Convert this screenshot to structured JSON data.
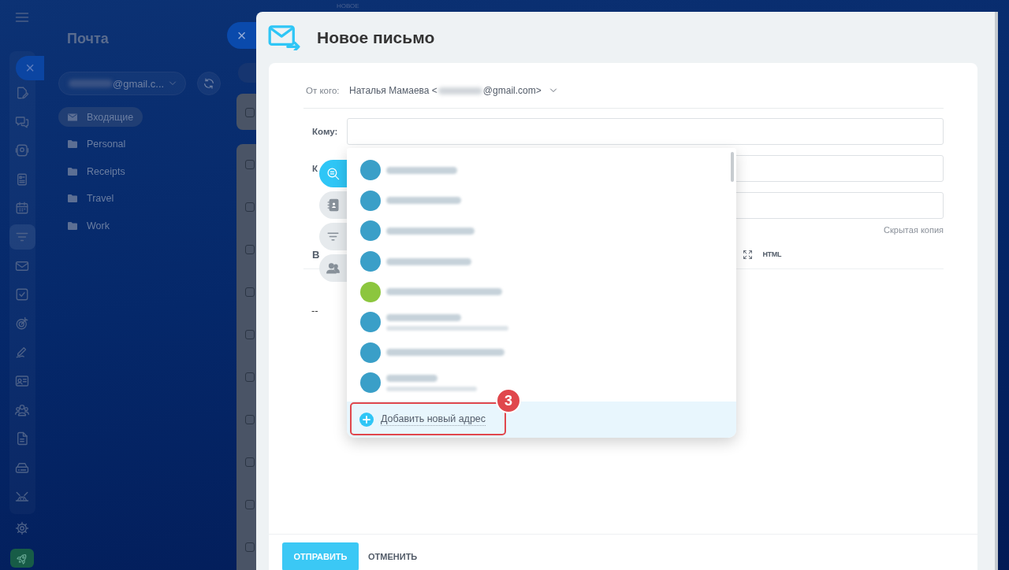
{
  "top_tab": {
    "label": "НОВОЕ"
  },
  "rail": {
    "close_button": {
      "label": "×"
    },
    "items": [
      {
        "kind": "edit",
        "selected": false
      },
      {
        "kind": "chat",
        "selected": false
      },
      {
        "kind": "contact",
        "selected": false
      },
      {
        "kind": "news",
        "selected": false
      },
      {
        "kind": "calendar",
        "selected": false
      },
      {
        "kind": "filter",
        "selected": true
      },
      {
        "kind": "mail",
        "selected": false
      },
      {
        "kind": "task",
        "selected": false
      },
      {
        "kind": "target",
        "selected": false
      },
      {
        "kind": "signature",
        "selected": false
      },
      {
        "kind": "id-card",
        "selected": false
      },
      {
        "kind": "people",
        "selected": false
      },
      {
        "kind": "document",
        "selected": false
      },
      {
        "kind": "drive",
        "selected": false
      },
      {
        "kind": "robot",
        "selected": false
      }
    ],
    "bottom_items": [
      {
        "kind": "settings"
      },
      {
        "kind": "rocket"
      }
    ]
  },
  "mail_panel": {
    "title": "Почта",
    "close_button": {
      "label": "×"
    },
    "account": {
      "visible_text": "@gmail.c..."
    },
    "folders": [
      {
        "kind": "inbox",
        "label": "Входящие",
        "selected": true
      },
      {
        "kind": "folder",
        "label": "Personal",
        "selected": false
      },
      {
        "kind": "folder",
        "label": "Receipts",
        "selected": false
      },
      {
        "kind": "folder",
        "label": "Travel",
        "selected": false
      },
      {
        "kind": "folder",
        "label": "Work",
        "selected": false
      }
    ]
  },
  "message_list": {
    "groups": [
      {
        "rows": [
          {
            "checked": false
          }
        ]
      },
      {
        "rows": [
          {
            "checked": false
          },
          {
            "checked": false
          },
          {
            "checked": false
          },
          {
            "checked": false
          },
          {
            "checked": false
          },
          {
            "checked": false
          },
          {
            "checked": false
          },
          {
            "checked": false
          },
          {
            "checked": false
          },
          {
            "checked": false
          }
        ]
      }
    ]
  },
  "compose": {
    "title": "Новое письмо",
    "from": {
      "label": "От кого:",
      "name": "Наталья Мамаева <",
      "domain": "@gmail.com>"
    },
    "fields": [
      {
        "kind": "labeled",
        "label": "Кому:"
      },
      {
        "kind": "labeled",
        "label": "К"
      },
      {
        "kind": "unlabeled"
      }
    ],
    "bcc_link": "Скрытая копия",
    "toolbar": {
      "bold": "B",
      "html": "HTML"
    },
    "body": "--",
    "recipient_tabs": [
      {
        "kind": "search",
        "selected": true
      },
      {
        "kind": "contacts",
        "selected": false
      },
      {
        "kind": "filter",
        "selected": false
      },
      {
        "kind": "groups",
        "selected": false
      }
    ],
    "dropdown": {
      "contacts": [
        {
          "kind": "email",
          "color": "#3a9fc8"
        },
        {
          "kind": "email",
          "color": "#3a9fc8"
        },
        {
          "kind": "email",
          "color": "#3a9fc8"
        },
        {
          "kind": "email",
          "color": "#3a9fc8"
        },
        {
          "kind": "email",
          "color": "#8cc63e"
        },
        {
          "kind": "name-email",
          "color": "#3a9fc8"
        },
        {
          "kind": "email",
          "color": "#3a9fc8"
        },
        {
          "kind": "name-email",
          "color": "#3a9fc8"
        }
      ],
      "add_button": "Добавить новый адрес"
    },
    "annotation": {
      "label": "3"
    },
    "buttons": [
      {
        "kind": "primary",
        "label": "ОТПРАВИТЬ"
      },
      {
        "kind": "link",
        "label": "ОТМЕНИТЬ"
      }
    ]
  }
}
